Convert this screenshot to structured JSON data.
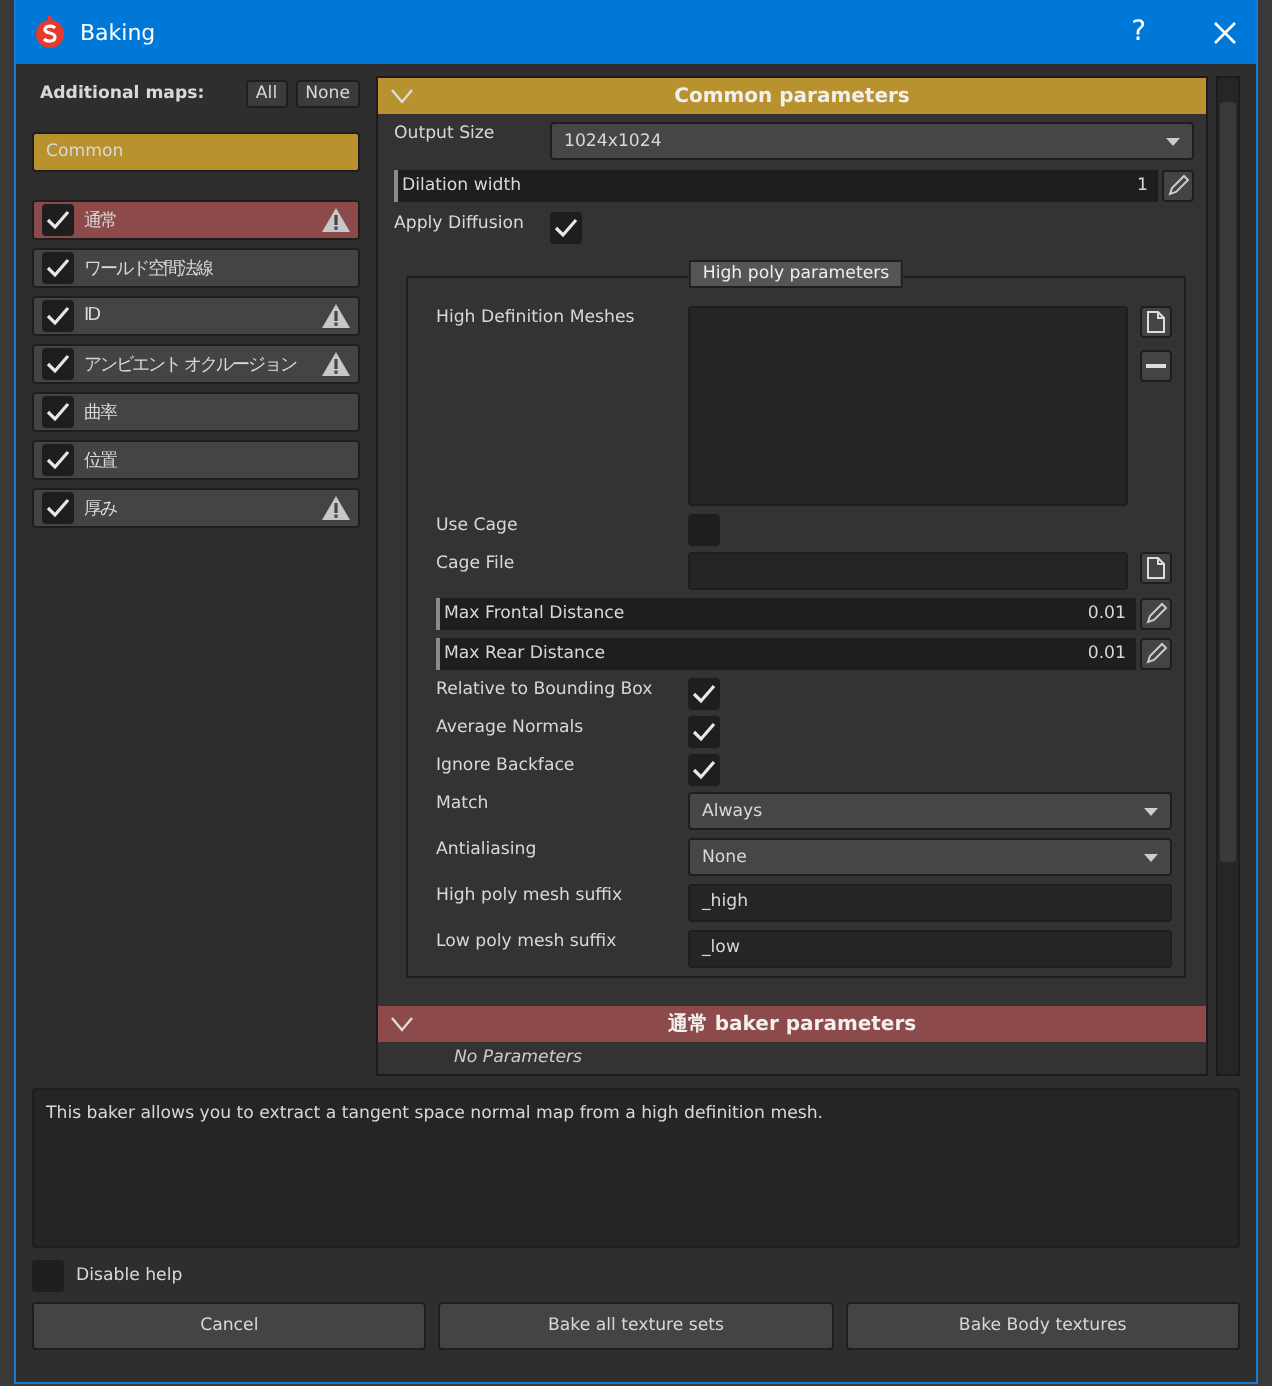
{
  "window": {
    "title": "Baking",
    "help": "?"
  },
  "additional_maps": {
    "label": "Additional maps:",
    "buttons": [
      "All",
      "None"
    ],
    "common": {
      "label": "Common",
      "selected": true
    },
    "maps": [
      {
        "label": "通常",
        "checked": true,
        "warning": true,
        "selected": true
      },
      {
        "label": "ワールド空間法線",
        "checked": true,
        "warning": false,
        "selected": false
      },
      {
        "label": "ID",
        "checked": true,
        "warning": true,
        "selected": false
      },
      {
        "label": "アンビエント オクルージョン",
        "checked": true,
        "warning": true,
        "selected": false
      },
      {
        "label": "曲率",
        "checked": true,
        "warning": false,
        "selected": false
      },
      {
        "label": "位置",
        "checked": true,
        "warning": false,
        "selected": false
      },
      {
        "label": "厚み",
        "checked": true,
        "warning": true,
        "selected": false
      }
    ]
  },
  "common_section": {
    "title": "Common parameters",
    "expanded": true,
    "fields": [
      {
        "kind": "dropdown",
        "label": "Output Size",
        "value": "1024x1024"
      },
      {
        "kind": "slider",
        "label": "Dilation width",
        "value": "1",
        "level": 0.006
      },
      {
        "kind": "checkbox",
        "label": "Apply Diffusion",
        "checked": true
      }
    ]
  },
  "high_poly": {
    "title": "High poly parameters",
    "fields": [
      {
        "kind": "list",
        "label": "High Definition Meshes"
      },
      {
        "kind": "checkbox",
        "label": "Use Cage",
        "checked": false
      },
      {
        "kind": "file",
        "label": "Cage File"
      },
      {
        "kind": "slider",
        "label": "Max Frontal Distance",
        "value": "0.01",
        "level": 0.006
      },
      {
        "kind": "slider",
        "label": "Max Rear Distance",
        "value": "0.01",
        "level": 0.006
      },
      {
        "kind": "checkbox",
        "label": "Relative to Bounding Box",
        "checked": true
      },
      {
        "kind": "checkbox",
        "label": "Average Normals",
        "checked": true
      },
      {
        "kind": "checkbox",
        "label": "Ignore Backface",
        "checked": true
      },
      {
        "kind": "dropdown",
        "label": "Match",
        "value": "Always"
      },
      {
        "kind": "dropdown",
        "label": "Antialiasing",
        "value": "None"
      },
      {
        "kind": "text",
        "label": "High poly mesh suffix",
        "value": "_high"
      },
      {
        "kind": "text",
        "label": "Low poly mesh suffix",
        "value": "_low"
      }
    ]
  },
  "baker_section": {
    "title": "通常 baker parameters",
    "expanded": true,
    "note": "No Parameters"
  },
  "help_text": "This baker allows you to extract a tangent space normal map from a high definition mesh.",
  "disable_help": {
    "label": "Disable help",
    "checked": false
  },
  "buttons": [
    "Cancel",
    "Bake all texture sets",
    "Bake Body textures"
  ]
}
